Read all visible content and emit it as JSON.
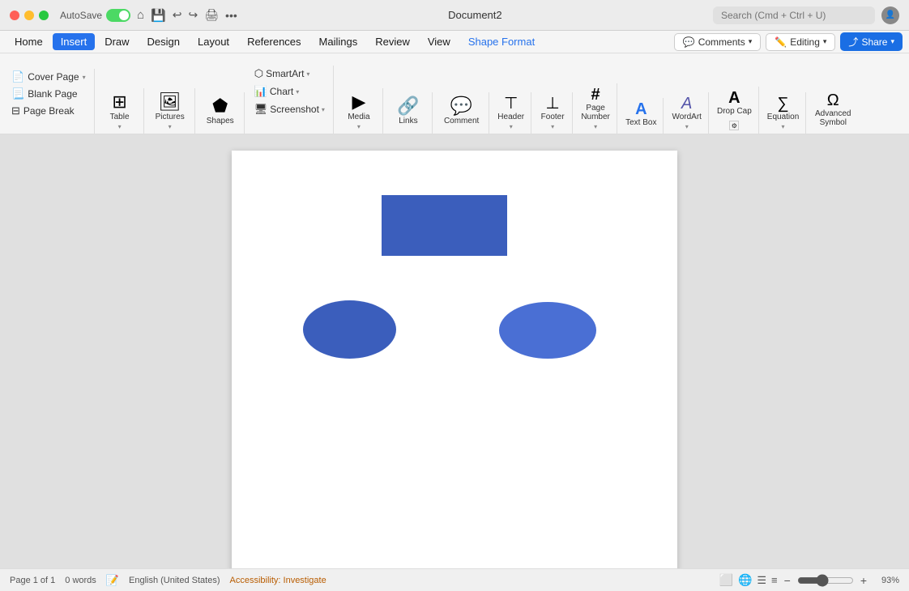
{
  "titlebar": {
    "autosave": "AutoSave",
    "document_title": "Document2",
    "search_placeholder": "Search (Cmd + Ctrl + U)",
    "controls": {
      "undo": "↩",
      "redo": "↪",
      "print": "🖨",
      "more": "•••"
    }
  },
  "menubar": {
    "items": [
      {
        "id": "home",
        "label": "Home",
        "active": false
      },
      {
        "id": "insert",
        "label": "Insert",
        "active": true
      },
      {
        "id": "draw",
        "label": "Draw",
        "active": false
      },
      {
        "id": "design",
        "label": "Design",
        "active": false
      },
      {
        "id": "layout",
        "label": "Layout",
        "active": false
      },
      {
        "id": "references",
        "label": "References",
        "active": false
      },
      {
        "id": "mailings",
        "label": "Mailings",
        "active": false
      },
      {
        "id": "review",
        "label": "Review",
        "active": false
      },
      {
        "id": "view",
        "label": "View",
        "active": false
      },
      {
        "id": "shape-format",
        "label": "Shape Format",
        "active": false,
        "accent": true
      }
    ]
  },
  "ribbon": {
    "groups": [
      {
        "id": "pages",
        "label": "",
        "items": [
          {
            "id": "cover-page",
            "label": "Cover Page",
            "has_caret": true
          },
          {
            "id": "blank-page",
            "label": "Blank Page"
          },
          {
            "id": "page-break",
            "label": "Page Break"
          }
        ]
      },
      {
        "id": "table",
        "label": "Table",
        "icon": "⊞",
        "has_caret": true
      },
      {
        "id": "pictures",
        "label": "Pictures",
        "icon": "🖼",
        "has_caret": true
      },
      {
        "id": "shapes",
        "label": "Shapes",
        "icon": "⬟",
        "has_caret": false
      },
      {
        "id": "smart-art",
        "label": "SmartArt",
        "icon": "⬡",
        "has_caret": true,
        "stacked": [
          {
            "id": "smart-art-item",
            "label": "SmartArt ▾"
          },
          {
            "id": "chart-item",
            "label": "Chart ▾"
          },
          {
            "id": "screenshot-item",
            "label": "Screenshot ▾"
          }
        ]
      },
      {
        "id": "media",
        "label": "Media",
        "icon": "▶",
        "has_caret": true
      },
      {
        "id": "links",
        "label": "Links",
        "icon": "🔗",
        "has_caret": false
      },
      {
        "id": "comment",
        "label": "Comment",
        "icon": "💬"
      },
      {
        "id": "header",
        "label": "Header",
        "icon": "⊤",
        "has_caret": true
      },
      {
        "id": "footer",
        "label": "Footer",
        "icon": "⊥",
        "has_caret": true
      },
      {
        "id": "page-number",
        "label": "Page Number",
        "icon": "#",
        "has_caret": true
      },
      {
        "id": "text-box",
        "label": "Text Box",
        "icon": "A"
      },
      {
        "id": "wordart",
        "label": "WordArt",
        "icon": "A",
        "has_caret": true
      },
      {
        "id": "drop-cap",
        "label": "Drop Cap",
        "icon": "A",
        "has_caret": false
      },
      {
        "id": "equation",
        "label": "Equation",
        "icon": "∑",
        "has_caret": true
      },
      {
        "id": "advanced-symbol",
        "label": "Advanced Symbol",
        "icon": "Ω"
      }
    ],
    "header_actions": {
      "comments_label": "Comments",
      "editing_label": "Editing",
      "share_label": "Share"
    }
  },
  "document": {
    "shapes": [
      {
        "id": "rect",
        "type": "rectangle",
        "color": "#3b5ebc",
        "label": "Rectangle"
      },
      {
        "id": "oval-left",
        "type": "ellipse",
        "color": "#3b5ebc",
        "label": "Ellipse Left"
      },
      {
        "id": "oval-right",
        "type": "ellipse",
        "color": "#4a6fd4",
        "label": "Ellipse Right"
      }
    ]
  },
  "statusbar": {
    "page_info": "Page 1 of 1",
    "word_count": "0 words",
    "language": "English (United States)",
    "accessibility": "Accessibility: Investigate",
    "zoom": "93%"
  }
}
